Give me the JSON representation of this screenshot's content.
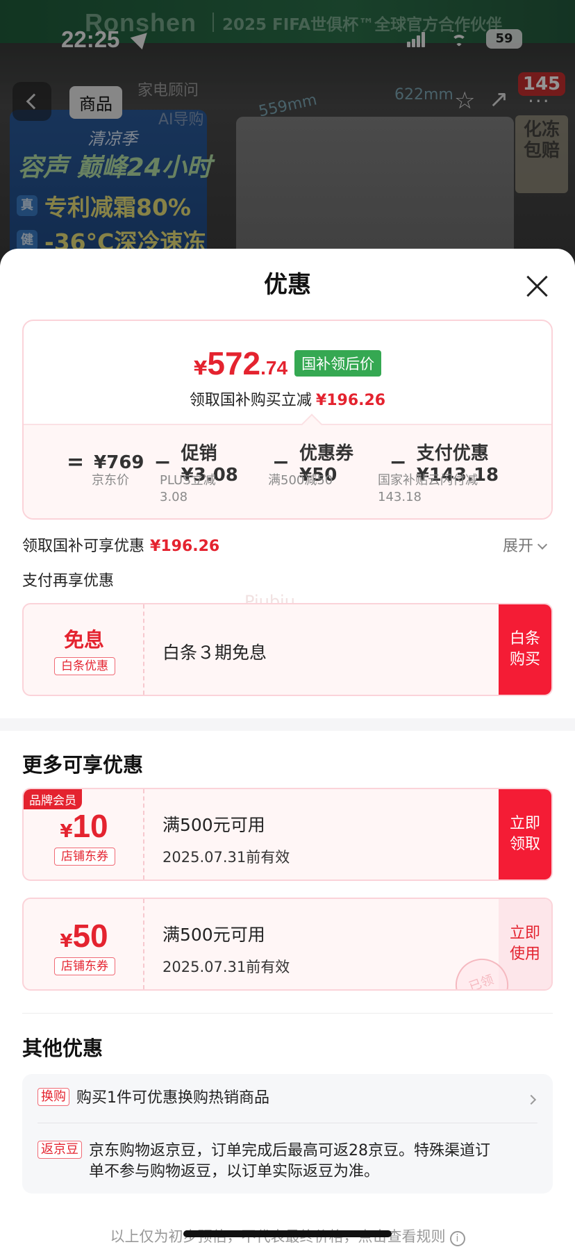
{
  "status_bar": {
    "time": "22:25",
    "battery": "59"
  },
  "background_page": {
    "brand": "Ronshen",
    "banner_text": "2025 FIFA世俱杯™全球官方合作伙伴",
    "tab_product": "商品",
    "tab_faded_1": "家电顾问",
    "tab_faded_2": "AI导购",
    "cart_count": "145",
    "promo_season": "清凉季",
    "promo_main": "容声 巅峰24小时",
    "promo_line_1_badge": "真",
    "promo_line_1": "专利减霜80%",
    "promo_line_2_badge": "健",
    "promo_line_2": "-36°C深冷速冻",
    "dim_1": "559mm",
    "dim_2": "622mm",
    "right_badge": "化冻包赔"
  },
  "sheet": {
    "title": "优惠",
    "price": {
      "yen": "¥",
      "integer": "572",
      "decimal": ".74",
      "tag": "国补领后价"
    },
    "price_sub": {
      "label": "领取国补购买立减",
      "amount": "¥196.26"
    },
    "formula": {
      "equals": "=",
      "jd_price": "¥769",
      "promo": "促销¥3.08",
      "coupon": "优惠券¥50",
      "payment": "支付优惠¥143.18",
      "minus": "−",
      "jd_price_label": "京东价",
      "promo_label_1": "PLUS立减",
      "promo_label_2": "3.08",
      "coupon_label": "满500减50",
      "payment_label_1": "国家补贴云闪付减",
      "payment_label_2": "143.18"
    },
    "benefit": {
      "label": "领取国补可享优惠",
      "amount": "¥196.26",
      "expand": "展开"
    },
    "pay_label": "支付再享优惠",
    "watermark": "Piubiu",
    "baitiao": {
      "big": "免息",
      "badge": "白条优惠",
      "main": "白条３期免息",
      "button_l1": "白条",
      "button_l2": "购买"
    },
    "more_title": "更多可享优惠",
    "coupon_1": {
      "brand_tag": "品牌会员",
      "yen": "¥",
      "amount": "10",
      "badge": "店铺东券",
      "main": "满500元可用",
      "sub": "2025.07.31前有效",
      "button_l1": "立即",
      "button_l2": "领取"
    },
    "coupon_2": {
      "yen": "¥",
      "amount": "50",
      "badge": "店铺东券",
      "main": "满500元可用",
      "sub": "2025.07.31前有效",
      "button_l1": "立即",
      "button_l2": "使用",
      "stamp": "已领"
    },
    "other_title": "其他优惠",
    "other": {
      "row1_tag": "换购",
      "row1_text": "购买1件可优惠换购热销商品",
      "row2_tag": "返京豆",
      "row2_text_1": "京东购物返京豆，订单完成后最高可返28京豆。特殊渠道订",
      "row2_text_2": "单不参与购物返豆，以订单实际返豆为准。"
    },
    "footer": "以上仅为初步预估，不代表最终价格，点击查看规则",
    "info_glyph": "i"
  }
}
